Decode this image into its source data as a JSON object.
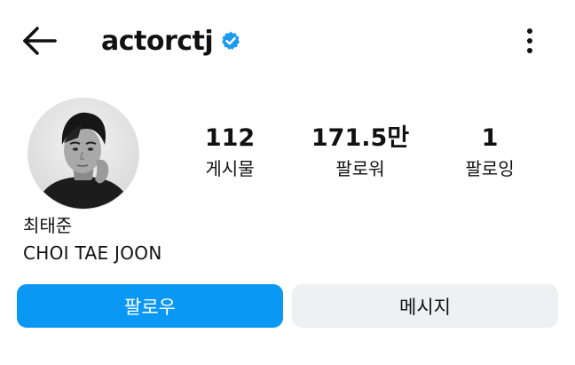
{
  "header": {
    "back_icon": "arrow-left-icon",
    "username": "actorctj",
    "verified_icon": "verified-badge-icon",
    "more_icon": "more-vertical-icon"
  },
  "profile": {
    "avatar": "profile-photo",
    "display_name": "최태준",
    "bio": "CHOI TAE JOON"
  },
  "stats": [
    {
      "value": "112",
      "label": "게시물"
    },
    {
      "value": "171.5만",
      "label": "팔로워"
    },
    {
      "value": "1",
      "label": "팔로잉"
    }
  ],
  "actions": {
    "follow_label": "팔로우",
    "message_label": "메시지"
  },
  "colors": {
    "accent": "#0b98f5",
    "secondary_button": "#eff0f2",
    "verified": "#1d9bf0",
    "text": "#111111"
  }
}
